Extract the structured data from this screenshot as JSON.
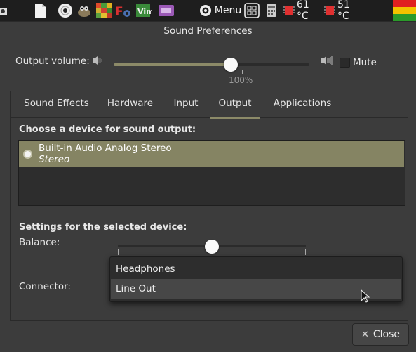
{
  "panel": {
    "menu_label": "Menu",
    "cpu_temp": "61 °C",
    "gpu_temp": "51 °C"
  },
  "window": {
    "title": "Sound Preferences"
  },
  "volume": {
    "label": "Output volume:",
    "percent_label": "100%",
    "level_percent": 60,
    "mute_label": "Mute",
    "mute_checked": false
  },
  "tabs": [
    {
      "label": "Sound Effects"
    },
    {
      "label": "Hardware"
    },
    {
      "label": "Input"
    },
    {
      "label": "Output",
      "active": true
    },
    {
      "label": "Applications"
    }
  ],
  "output": {
    "choose_heading": "Choose a device for sound output:",
    "devices": [
      {
        "name": "Built-in Audio Analog Stereo",
        "profile": "Stereo",
        "selected": true
      }
    ],
    "settings_heading": "Settings for the selected device:",
    "balance_label": "Balance:",
    "balance_percent": 50,
    "connector_label": "Connector:",
    "connector_options": [
      "Headphones",
      "Line Out"
    ],
    "connector_highlighted": "Line Out"
  },
  "buttons": {
    "close_label": "Close"
  },
  "colors": {
    "accent": "#858463",
    "panel_bg": "#1e1e1e",
    "window_bg": "#3c3c3c"
  }
}
